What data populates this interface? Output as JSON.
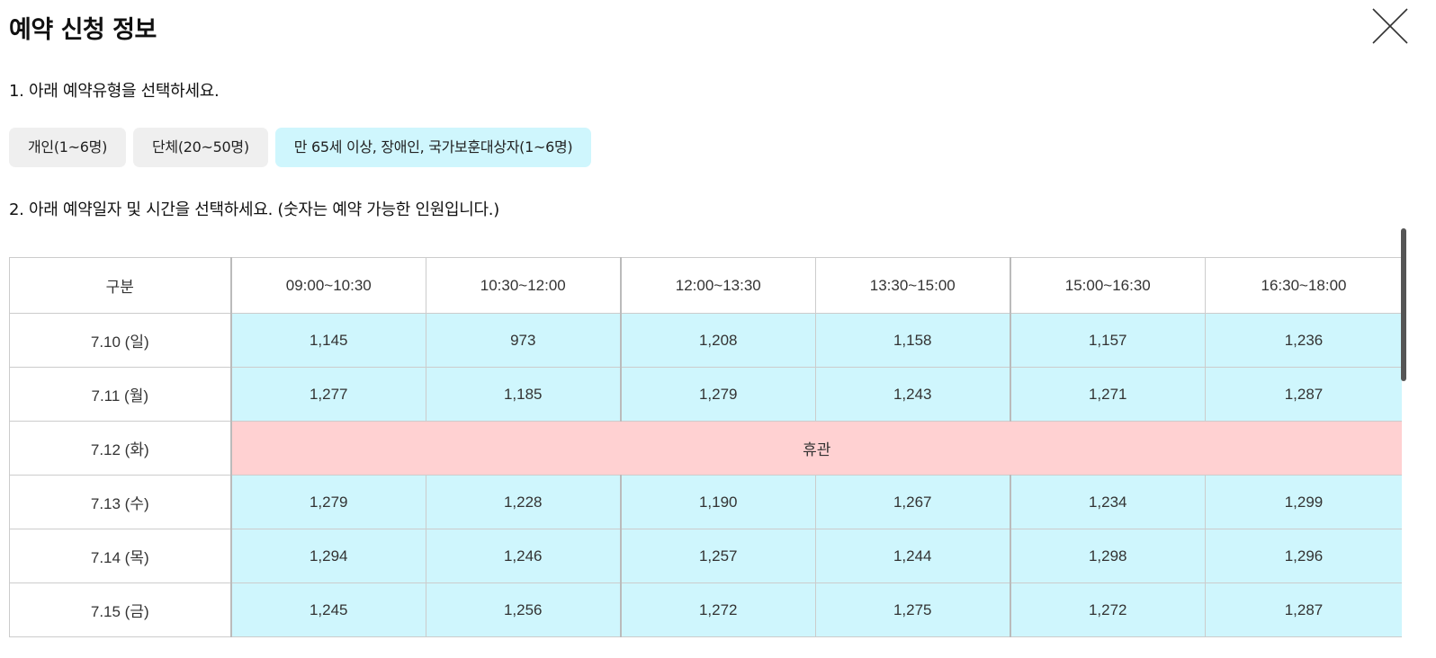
{
  "modal": {
    "title": "예약 신청 정보"
  },
  "step1": {
    "label": "1. 아래 예약유형을 선택하세요.",
    "types": [
      {
        "label": "개인(1~6명)",
        "selected": false
      },
      {
        "label": "단체(20~50명)",
        "selected": false
      },
      {
        "label": "만 65세 이상, 장애인, 국가보훈대상자(1~6명)",
        "selected": true
      }
    ]
  },
  "step2": {
    "label": "2. 아래 예약일자 및 시간을 선택하세요. (숫자는 예약 가능한 인원입니다.)"
  },
  "schedule": {
    "header": {
      "first": "구분",
      "slots": [
        "09:00~10:30",
        "10:30~12:00",
        "12:00~13:30",
        "13:30~15:00",
        "15:00~16:30",
        "16:30~18:00"
      ]
    },
    "rows": [
      {
        "date": "7.10 (일)",
        "values": [
          "1,145",
          "973",
          "1,208",
          "1,158",
          "1,157",
          "1,236"
        ]
      },
      {
        "date": "7.11 (월)",
        "values": [
          "1,277",
          "1,185",
          "1,279",
          "1,243",
          "1,271",
          "1,287"
        ]
      },
      {
        "date": "7.12 (화)",
        "closed": "휴관"
      },
      {
        "date": "7.13 (수)",
        "values": [
          "1,279",
          "1,228",
          "1,190",
          "1,267",
          "1,234",
          "1,299"
        ]
      },
      {
        "date": "7.14 (목)",
        "values": [
          "1,294",
          "1,246",
          "1,257",
          "1,244",
          "1,298",
          "1,296"
        ]
      },
      {
        "date": "7.15 (금)",
        "values": [
          "1,245",
          "1,256",
          "1,272",
          "1,275",
          "1,272",
          "1,287"
        ]
      }
    ]
  },
  "colors": {
    "available": "#cff6fd",
    "closed": "#ffd1d2",
    "selected_type": "#cff6fd",
    "unselected_type": "#efefef"
  },
  "icons": {
    "close": "close-icon"
  }
}
